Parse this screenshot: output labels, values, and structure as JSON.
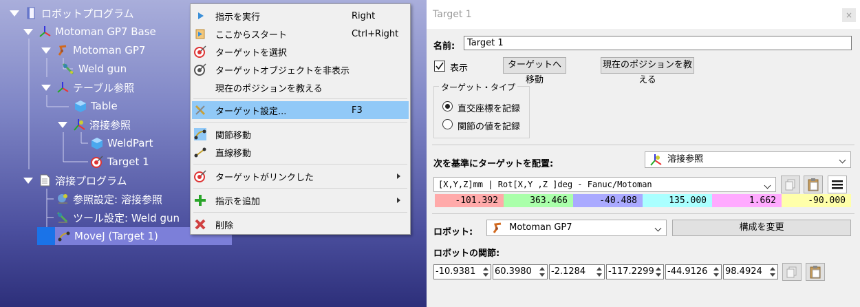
{
  "tree": {
    "items": [
      {
        "label": "ロボットプログラム"
      },
      {
        "label": "Motoman GP7 Base"
      },
      {
        "label": "Motoman GP7"
      },
      {
        "label": "Weld gun"
      },
      {
        "label": "テーブル参照"
      },
      {
        "label": "Table"
      },
      {
        "label": "溶接参照"
      },
      {
        "label": "WeldPart"
      },
      {
        "label": "Target 1"
      },
      {
        "label": "溶接プログラム"
      },
      {
        "label": "参照設定: 溶接参照"
      },
      {
        "label": "ツール設定: Weld gun"
      },
      {
        "label": "MoveJ (Target 1)"
      }
    ]
  },
  "menu": {
    "items": [
      {
        "label": "指示を実行",
        "shortcut": "Right"
      },
      {
        "label": "ここからスタート",
        "shortcut": "Ctrl+Right"
      },
      {
        "label": "ターゲットを選択",
        "shortcut": ""
      },
      {
        "label": "ターゲットオブジェクトを非表示",
        "shortcut": ""
      },
      {
        "label": "現在のポジションを教える",
        "shortcut": ""
      },
      {
        "label": "ターゲット設定...",
        "shortcut": "F3"
      },
      {
        "label": "関節移動",
        "shortcut": ""
      },
      {
        "label": "直線移動",
        "shortcut": ""
      },
      {
        "label": "ターゲットがリンクした",
        "shortcut": ""
      },
      {
        "label": "指示を追加",
        "shortcut": ""
      },
      {
        "label": "削除",
        "shortcut": ""
      }
    ]
  },
  "panel": {
    "title": "Target 1",
    "close": "×",
    "name_label": "名前:",
    "name_value": "Target 1",
    "show_label": "表示",
    "move_to_target_button": "ターゲットへ移動",
    "teach_position_button": "現在のポジションを教える",
    "target_type": {
      "title": "ターゲット・タイプ",
      "cartesian": "直交座標を記録",
      "joints": "関節の値を記録"
    },
    "place_relative_label": "次を基準にターゲットを配置:",
    "reference_frame": "溶接参照",
    "format": "[X,Y,Z]mm | Rot[X,Y ,Z  ]deg - Fanuc/Motoman",
    "coords": [
      "-101.392",
      "363.466",
      "-40.488",
      "135.000",
      "1.662",
      "-90.000"
    ],
    "robot_label": "ロボット:",
    "robot_value": "Motoman GP7",
    "change_config_button": "構成を変更",
    "joints_label": "ロボットの関節:",
    "joints": [
      "-10.9381",
      "60.3980",
      "-2.1284",
      "-117.2299",
      "-44.9126",
      "98.4924"
    ]
  },
  "colors": {
    "coord_bg": [
      "#ffaaaa",
      "#aaffaa",
      "#aaaaff",
      "#aaffff",
      "#ffaaff",
      "#ffffaa"
    ],
    "menu_highlight": "#91c9f7",
    "selection": "#7c7fd9"
  }
}
